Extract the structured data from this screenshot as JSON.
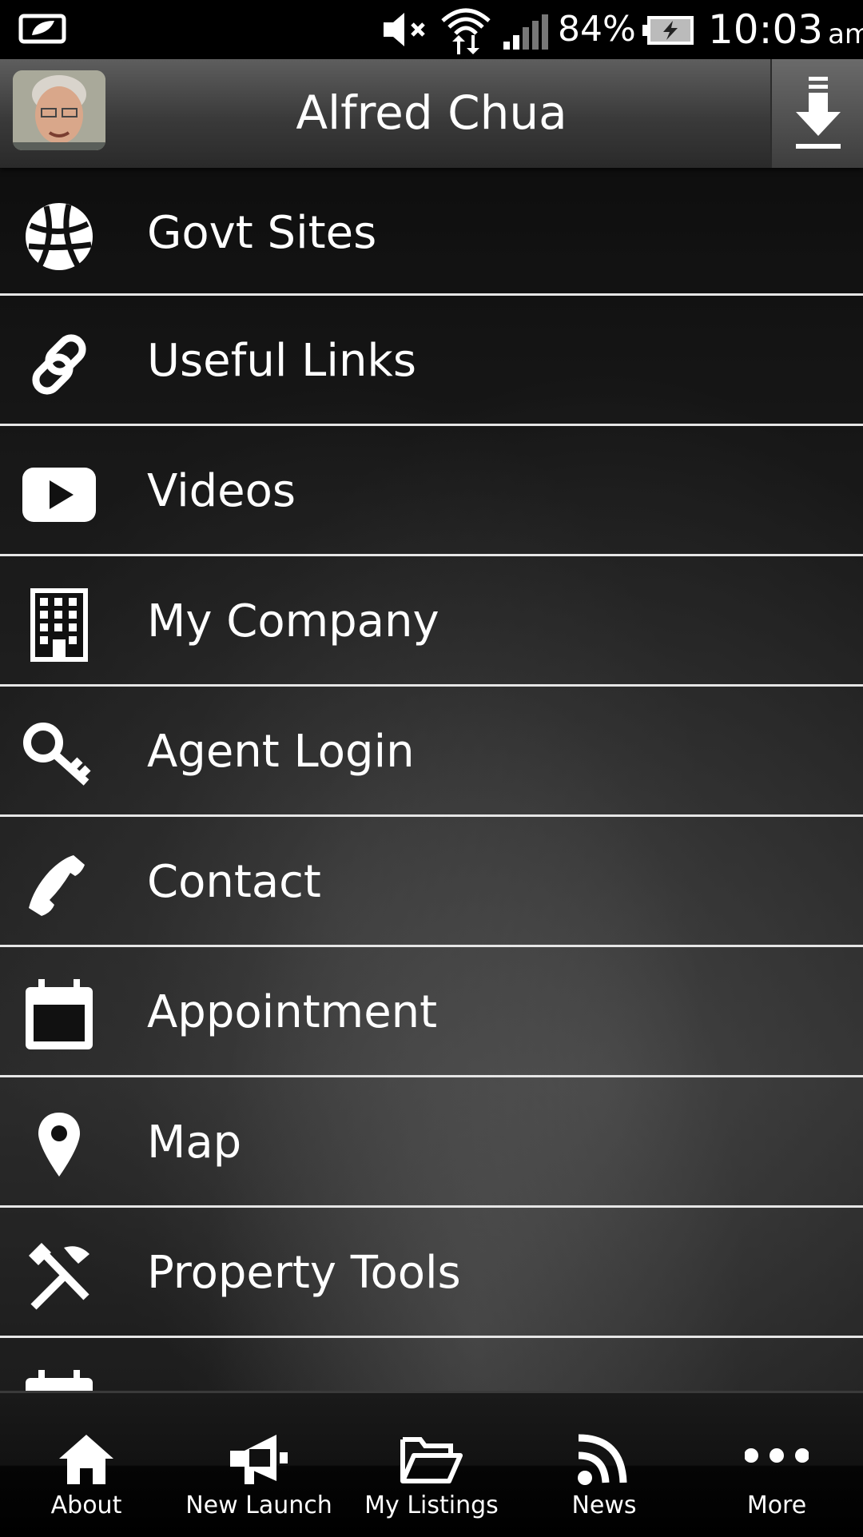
{
  "status_bar": {
    "battery_percent": "84%",
    "time": "10:03",
    "ampm": "am"
  },
  "header": {
    "title": "Alfred Chua"
  },
  "menu": {
    "items": [
      {
        "label": "Govt Sites",
        "icon": "globe-icon"
      },
      {
        "label": "Useful Links",
        "icon": "link-icon"
      },
      {
        "label": "Videos",
        "icon": "play-icon"
      },
      {
        "label": "My Company",
        "icon": "building-icon"
      },
      {
        "label": "Agent Login",
        "icon": "key-icon"
      },
      {
        "label": "Contact",
        "icon": "phone-icon"
      },
      {
        "label": "Appointment",
        "icon": "calendar-icon"
      },
      {
        "label": "Map",
        "icon": "map-pin-icon"
      },
      {
        "label": "Property Tools",
        "icon": "tools-icon"
      }
    ]
  },
  "bottom_nav": {
    "items": [
      {
        "label": "About",
        "icon": "home-icon"
      },
      {
        "label": "New Launch",
        "icon": "megaphone-icon"
      },
      {
        "label": "My Listings",
        "icon": "folder-open-icon"
      },
      {
        "label": "News",
        "icon": "rss-icon"
      },
      {
        "label": "More",
        "icon": "more-dots-icon"
      }
    ]
  }
}
